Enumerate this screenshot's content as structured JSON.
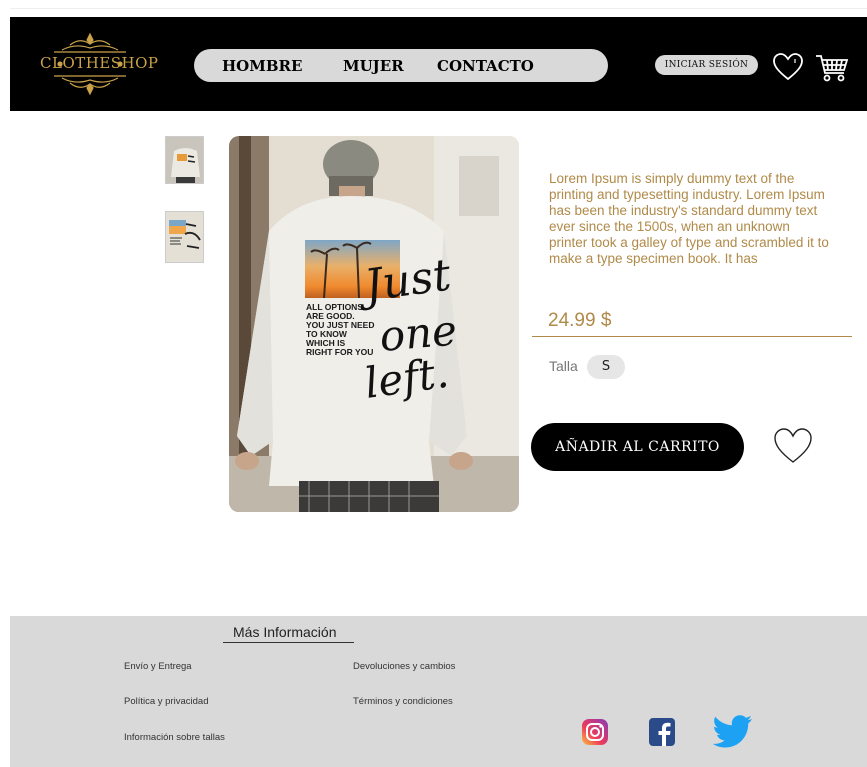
{
  "brand": {
    "logo_text": "CLOTHESHOP"
  },
  "nav": {
    "items": [
      "HOMBRE",
      "MUJER",
      "CONTACTO"
    ]
  },
  "header": {
    "login_label": "INICIAR SESIÓN"
  },
  "product": {
    "description": "Lorem Ipsum is simply dummy text of the printing and typesetting industry. Lorem Ipsum has been the industry's standard dummy text ever since the 1500s, when an unknown printer took a galley of type and scrambled it to make a type specimen book. It has",
    "price": "24.99 $",
    "size_label": "Talla",
    "size_value": "S",
    "add_to_cart": "AÑADIR  AL CARRITO",
    "shirt_print_text": [
      "ALL OPTIONS",
      "ARE GOOD.",
      "YOU JUST NEED",
      "TO KNOW",
      "WHICH IS",
      "RIGHT FOR YOU"
    ],
    "shirt_graffiti": [
      "Just",
      "one",
      "left."
    ]
  },
  "footer": {
    "title": "Más Información",
    "links": [
      "Envío y Entrega",
      "Devoluciones y cambios",
      "Política y privacidad",
      "Términos y condiciones",
      "Información sobre tallas"
    ]
  },
  "colors": {
    "accent": "#b08a48",
    "header_bg": "#000000",
    "footer_bg": "#d9d9d9",
    "logo_gold": "#c9a24a"
  }
}
